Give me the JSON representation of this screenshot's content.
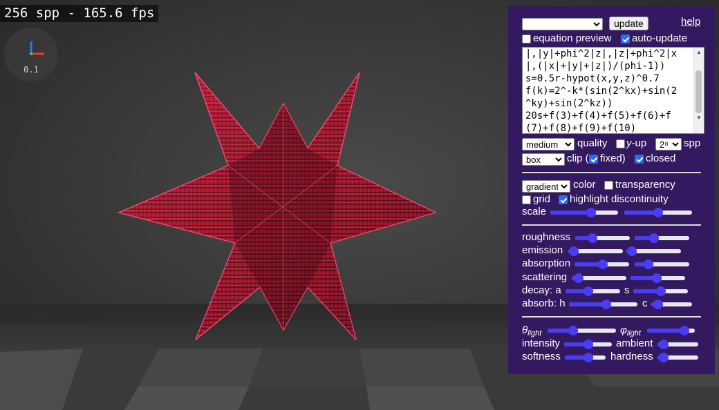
{
  "stats": "256 spp - 165.6 fps",
  "axis_scale": "0.1",
  "panel": {
    "equation_select": "",
    "update_label": "update",
    "help_label": "help",
    "equation_preview": {
      "label": "equation preview",
      "checked": false
    },
    "auto_update": {
      "label": "auto-update",
      "checked": true
    },
    "code_lines": [
      "|,|y|+phi^2|z|,|z|+phi^2|x",
      "|,(|x|+|y|+|z|)/(phi-1))",
      "s=0.5r-hypot(x,y,z)^0.7",
      "f(k)=2^-k*(sin(2^kx)+sin(2",
      "^ky)+sin(2^kz))",
      "20s+f(3)+f(4)+f(5)+f(6)+f",
      "(7)+f(8)+f(9)+f(10)"
    ],
    "quality": {
      "value": "medium",
      "label": "quality"
    },
    "y_up": {
      "label": "y",
      "suffix": "-up",
      "checked": false
    },
    "spp": {
      "value": "2⁸",
      "label": "spp"
    },
    "clip": {
      "value": "box",
      "label": "clip (",
      "fixed_label": "fixed)",
      "fixed_checked": true
    },
    "closed": {
      "label": "closed",
      "checked": true
    },
    "color": {
      "value": "gradient",
      "label": "color"
    },
    "transparency": {
      "label": "transparency",
      "checked": false
    },
    "grid": {
      "label": "grid",
      "checked": false
    },
    "highlight": {
      "label": "highlight discontinuity",
      "checked": true
    },
    "scale": {
      "label": "scale",
      "v1": 0.62,
      "v2": 0.5
    },
    "material": {
      "roughness": {
        "label": "roughness",
        "v1": 0.28,
        "v2": 0.32
      },
      "emission": {
        "label": "emission",
        "v1": 0.02,
        "v2": 0.02
      },
      "absorption": {
        "label": "absorption",
        "v1": 0.52,
        "v2": 0.2
      },
      "scattering": {
        "label": "scattering",
        "v1": 0.04,
        "v2": 0.48
      },
      "decay": {
        "label": "decay: a",
        "s_label": "s",
        "v1": 0.4,
        "v2": 0.5
      },
      "absorb": {
        "label": "absorb: h",
        "c_label": "c",
        "v1": 0.55,
        "v2": 0.07
      }
    },
    "light": {
      "theta": {
        "label": "θ",
        "sub": "light",
        "v": 0.35
      },
      "phi": {
        "label": "φ",
        "sub": "light",
        "v": 0.85
      },
      "intensity": {
        "label": "intensity",
        "v": 0.5
      },
      "ambient": {
        "label": "ambient",
        "v": 0.05
      },
      "softness": {
        "label": "softness",
        "v": 0.6
      },
      "hardness": {
        "label": "hardness",
        "v": 0.05
      }
    }
  }
}
